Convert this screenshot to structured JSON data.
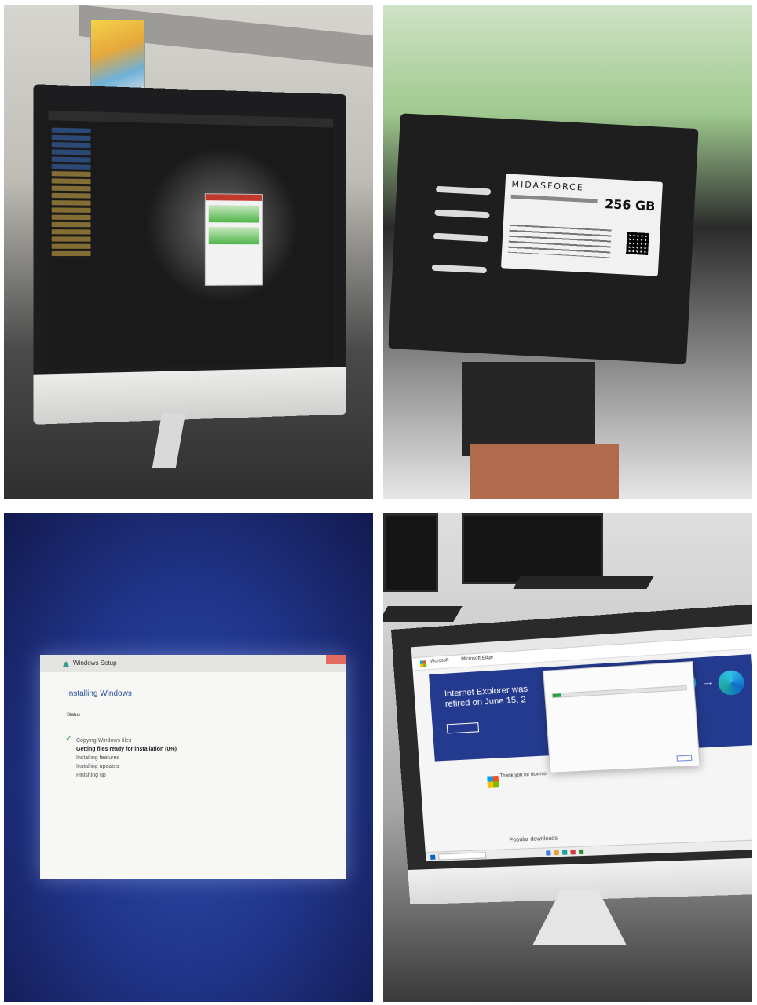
{
  "panel_top_left": {
    "description_icon": "monitor-file-explorer"
  },
  "panel_top_right": {
    "ssd": {
      "brand": "MIDASFORCE",
      "capacity": "256 GB"
    }
  },
  "panel_bottom_left": {
    "setup": {
      "window_title": "Windows Setup",
      "heading": "Installing Windows",
      "status_label": "Status",
      "steps": [
        {
          "label": "Copying Windows files",
          "state": "done"
        },
        {
          "label": "Getting files ready for installation (0%)",
          "state": "active"
        },
        {
          "label": "Installing features",
          "state": "pending"
        },
        {
          "label": "Installing updates",
          "state": "pending"
        },
        {
          "label": "Finishing up",
          "state": "pending"
        }
      ],
      "check_glyph": "✓"
    }
  },
  "panel_bottom_right": {
    "page": {
      "brand": "Microsoft",
      "nav": "Microsoft Edge",
      "hero_line1": "Internet Explorer was",
      "hero_line2": "retired on June 15, 2",
      "section": "Thank you for downlo",
      "popular": "Popular downloads"
    },
    "download_dialog": {
      "progress": 0.06
    },
    "colors": {
      "hero": "#243a8e",
      "progress": "#23a337"
    }
  }
}
